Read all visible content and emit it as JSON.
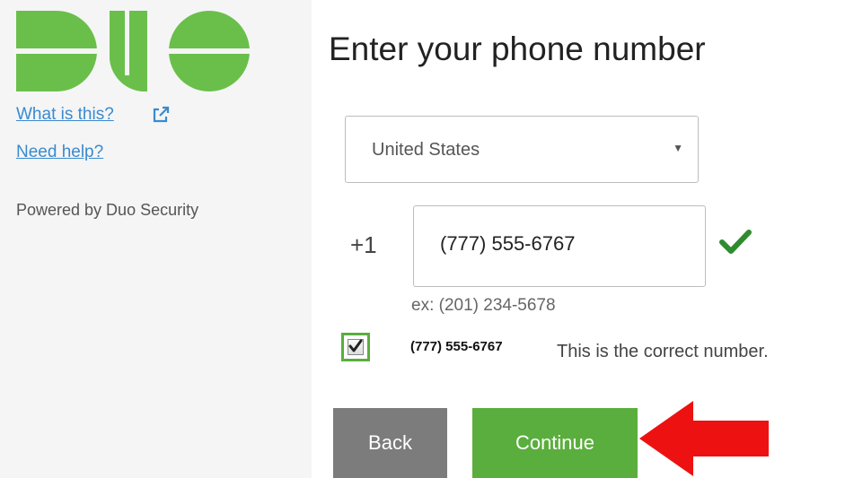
{
  "sidebar": {
    "logo": {
      "name": "duo-logo",
      "color": "#6abf4b"
    },
    "links": [
      {
        "label": "What is this?",
        "icon": "external-link-icon"
      },
      {
        "label": "Need help?"
      }
    ],
    "powered_by": "Powered by Duo Security"
  },
  "main": {
    "title": "Enter your phone number",
    "country_select": {
      "value": "United States",
      "caret_icon": "dropdown-caret-icon"
    },
    "phone": {
      "prefix": "+1",
      "value": "(777) 555-6767",
      "valid_icon": "checkmark-icon",
      "example": "ex: (201) 234-5678"
    },
    "confirm": {
      "checked": true,
      "number": "(777) 555-6767",
      "label": "This is the correct number."
    },
    "buttons": {
      "back": "Back",
      "continue": "Continue"
    },
    "annotation": {
      "icon": "red-arrow-icon",
      "color": "#ee1111"
    }
  },
  "colors": {
    "accent_green": "#5aae3d",
    "link_blue": "#3a8ad0",
    "back_gray": "#7c7c7c",
    "sidebar_bg": "#f5f5f5"
  }
}
